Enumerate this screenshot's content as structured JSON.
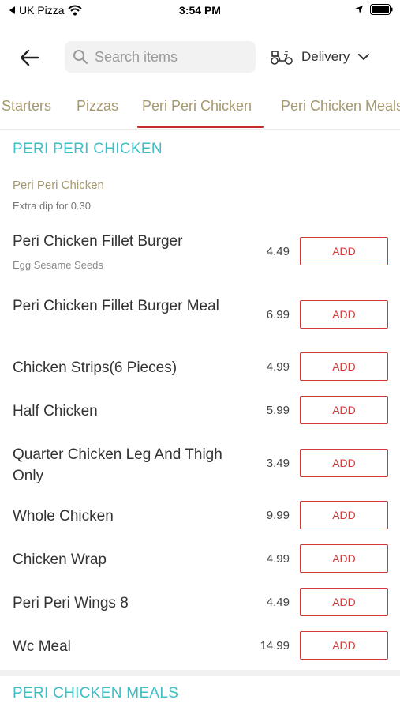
{
  "status_bar": {
    "carrier": "UK Pizza",
    "time": "3:54 PM"
  },
  "header": {
    "search_placeholder": "Search items",
    "delivery_label": "Delivery"
  },
  "tabs": [
    {
      "label": "Starters",
      "active": false
    },
    {
      "label": "Pizzas",
      "active": false
    },
    {
      "label": "Peri Peri Chicken",
      "active": true
    },
    {
      "label": "Peri Chicken Meals",
      "active": false
    }
  ],
  "section": {
    "heading": "PERI PERI CHICKEN",
    "subtitle": "Peri Peri Chicken",
    "note": "Extra dip for 0.30"
  },
  "items": [
    {
      "name": "Peri Chicken Fillet Burger",
      "description": "Egg Sesame Seeds",
      "price": "4.49",
      "button": "ADD"
    },
    {
      "name": "Peri Chicken Fillet Burger Meal",
      "description": "",
      "price": "6.99",
      "button": "ADD"
    },
    {
      "name": "Chicken Strips(6 Pieces)",
      "description": "",
      "price": "4.99",
      "button": "ADD"
    },
    {
      "name": "Half Chicken",
      "description": "",
      "price": "5.99",
      "button": "ADD"
    },
    {
      "name": "Quarter Chicken Leg And Thigh Only",
      "description": "",
      "price": "3.49",
      "button": "ADD"
    },
    {
      "name": "Whole Chicken",
      "description": "",
      "price": "9.99",
      "button": "ADD"
    },
    {
      "name": "Chicken Wrap",
      "description": "",
      "price": "4.99",
      "button": "ADD"
    },
    {
      "name": "Peri Peri Wings 8",
      "description": "",
      "price": "4.49",
      "button": "ADD"
    },
    {
      "name": "Wc Meal",
      "description": "",
      "price": "14.99",
      "button": "ADD"
    }
  ],
  "next_section": {
    "heading": "PERI CHICKEN MEALS"
  },
  "colors": {
    "accent_teal": "#3cbfc6",
    "accent_red": "#d23a3a",
    "tab_text": "#a6996e"
  }
}
